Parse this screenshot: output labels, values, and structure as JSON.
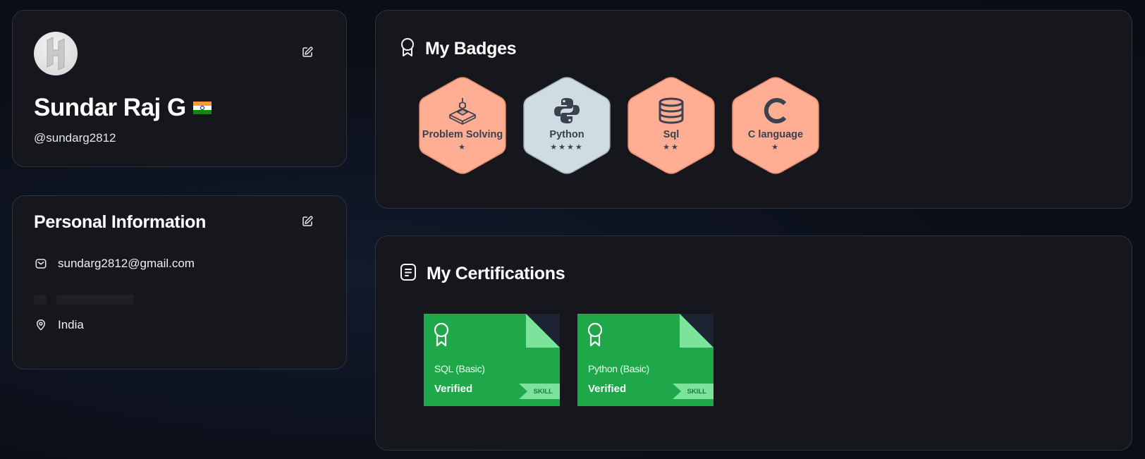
{
  "profile": {
    "name": "Sundar Raj G",
    "handle": "@sundarg2812",
    "avatar_initial": "H",
    "country_flag": "india-flag"
  },
  "personal_info": {
    "title": "Personal Information",
    "email": "sundarg2812@gmail.com",
    "location": "India"
  },
  "badges": {
    "title": "My Badges",
    "items": [
      {
        "label": "Problem Solving",
        "stars": "★",
        "color": "#ffad93",
        "icon": "problem-solving-icon"
      },
      {
        "label": "Python",
        "stars": "★★★★",
        "color": "#cfdde2",
        "icon": "python-icon"
      },
      {
        "label": "Sql",
        "stars": "★★",
        "color": "#ffad93",
        "icon": "database-icon"
      },
      {
        "label": "C language",
        "stars": "★",
        "color": "#ffad93",
        "icon": "c-language-icon"
      }
    ]
  },
  "certifications": {
    "title": "My Certifications",
    "items": [
      {
        "name": "SQL (Basic)",
        "status": "Verified",
        "tag": "SKILL"
      },
      {
        "name": "Python (Basic)",
        "status": "Verified",
        "tag": "SKILL"
      }
    ]
  },
  "colors": {
    "card_bg": "#15171c",
    "card_border": "#2e323b",
    "cert_green": "#1ea84a",
    "badge_bronze": "#ffad93",
    "badge_silver": "#cfdde2"
  }
}
